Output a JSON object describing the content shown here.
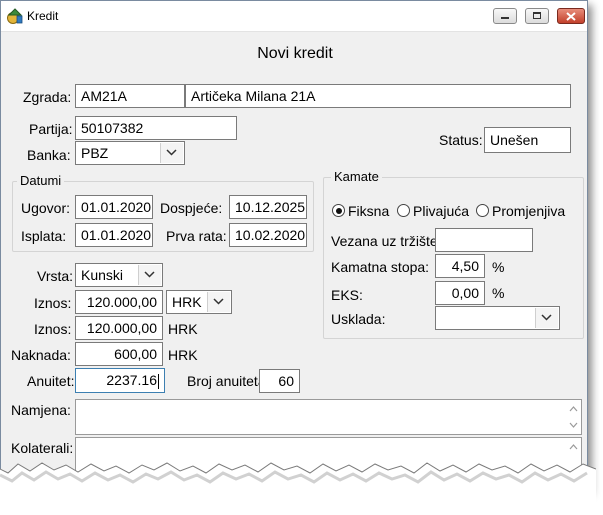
{
  "window": {
    "title": "Kredit"
  },
  "form_title": "Novi kredit",
  "zgrada": {
    "label": "Zgrada:",
    "code": "AM21A",
    "address": "Artičeka Milana 21A"
  },
  "partija": {
    "label": "Partija:",
    "value": "50107382"
  },
  "status": {
    "label": "Status:",
    "value": "Unešen"
  },
  "banka": {
    "label": "Banka:",
    "value": "PBZ"
  },
  "datumi": {
    "title": "Datumi",
    "ugovor_label": "Ugovor:",
    "ugovor": "01.01.2020",
    "dospijece_label": "Dospjeće:",
    "dospijece": "10.12.2025",
    "isplata_label": "Isplata:",
    "isplata": "01.01.2020",
    "prva_rata_label": "Prva rata:",
    "prva_rata": "10.02.2020"
  },
  "kamate": {
    "title": "Kamate",
    "options": [
      "Fiksna",
      "Plivajuća",
      "Promjenjiva"
    ],
    "selected": "Fiksna",
    "vezana_label": "Vezana uz tržište:",
    "vezana": "",
    "kamatna_label": "Kamatna stopa:",
    "kamatna": "4,50",
    "kamatna_unit": "%",
    "eks_label": "EKS:",
    "eks": "0,00",
    "eks_unit": "%",
    "usklada_label": "Usklada:",
    "usklada": ""
  },
  "vrsta": {
    "label": "Vrsta:",
    "value": "Kunski"
  },
  "iznos1": {
    "label": "Iznos:",
    "value": "120.000,00",
    "currency": "HRK"
  },
  "iznos2": {
    "label": "Iznos:",
    "value": "120.000,00",
    "currency": "HRK"
  },
  "naknada": {
    "label": "Naknada:",
    "value": "600,00",
    "currency": "HRK"
  },
  "anuitet": {
    "label": "Anuitet:",
    "value": "2237.16"
  },
  "broj_anuiteta": {
    "label": "Broj anuiteta:",
    "value": "60"
  },
  "namjena": {
    "label": "Namjena:",
    "value": ""
  },
  "kolaterali": {
    "label": "Kolaterali:",
    "value": ""
  }
}
